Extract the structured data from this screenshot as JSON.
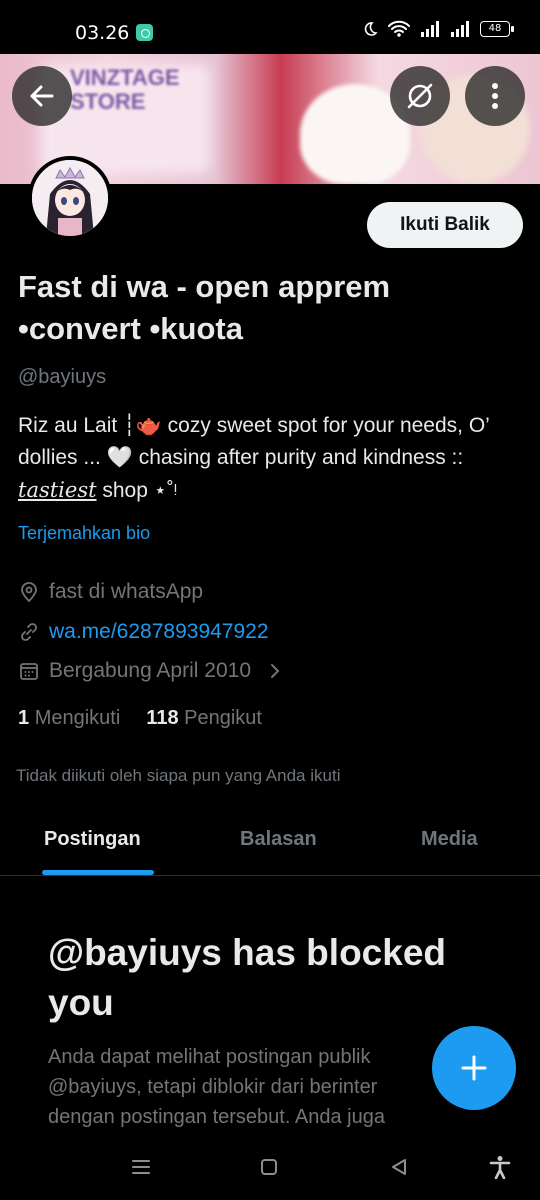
{
  "status_bar": {
    "time": "03.26",
    "battery": "48",
    "icons": [
      "moon-icon",
      "wifi-icon",
      "signal-icon",
      "signal-icon",
      "battery-icon"
    ]
  },
  "banner": {
    "text_line1": "VINZTAGE",
    "text_line2": "STORE"
  },
  "header": {
    "back_icon": "arrow-left-icon",
    "grok_icon": "slash-circle-icon",
    "more_icon": "more-vertical-icon"
  },
  "profile": {
    "follow_button": "Ikuti Balik",
    "display_name": "Fast di wa - open apprem •convert •kuota",
    "handle": "@bayiuys",
    "bio_part1": "Riz au Lait ┆🫖  cozy sweet spot for your needs, O’ dollies ... 🤍 chasing after purity and kindness :: ",
    "bio_fancy": "tastiest",
    "bio_part2": " shop        ⋆˚ᵎ",
    "translate": "Terjemahkan bio",
    "location": "fast di whatsApp",
    "website": "wa.me/6287893947922",
    "joined": "Bergabung April 2010",
    "following_count": "1",
    "following_label": "Mengikuti",
    "followers_count": "118",
    "followers_label": "Pengikut",
    "followed_note": "Tidak diikuti oleh siapa pun yang Anda ikuti"
  },
  "tabs": [
    "Postingan",
    "Balasan",
    "Media"
  ],
  "blocked": {
    "title": "@bayiuys has blocked you",
    "line1": "Anda dapat melihat postingan publik",
    "line2": "@bayiuys, tetapi diblokir dari berinter",
    "line3": "dengan postingan tersebut. Anda juga"
  },
  "colors": {
    "accent": "#1d9bf0",
    "background": "#000000",
    "text_primary": "#e7e9ea",
    "text_secondary": "#71767b"
  }
}
